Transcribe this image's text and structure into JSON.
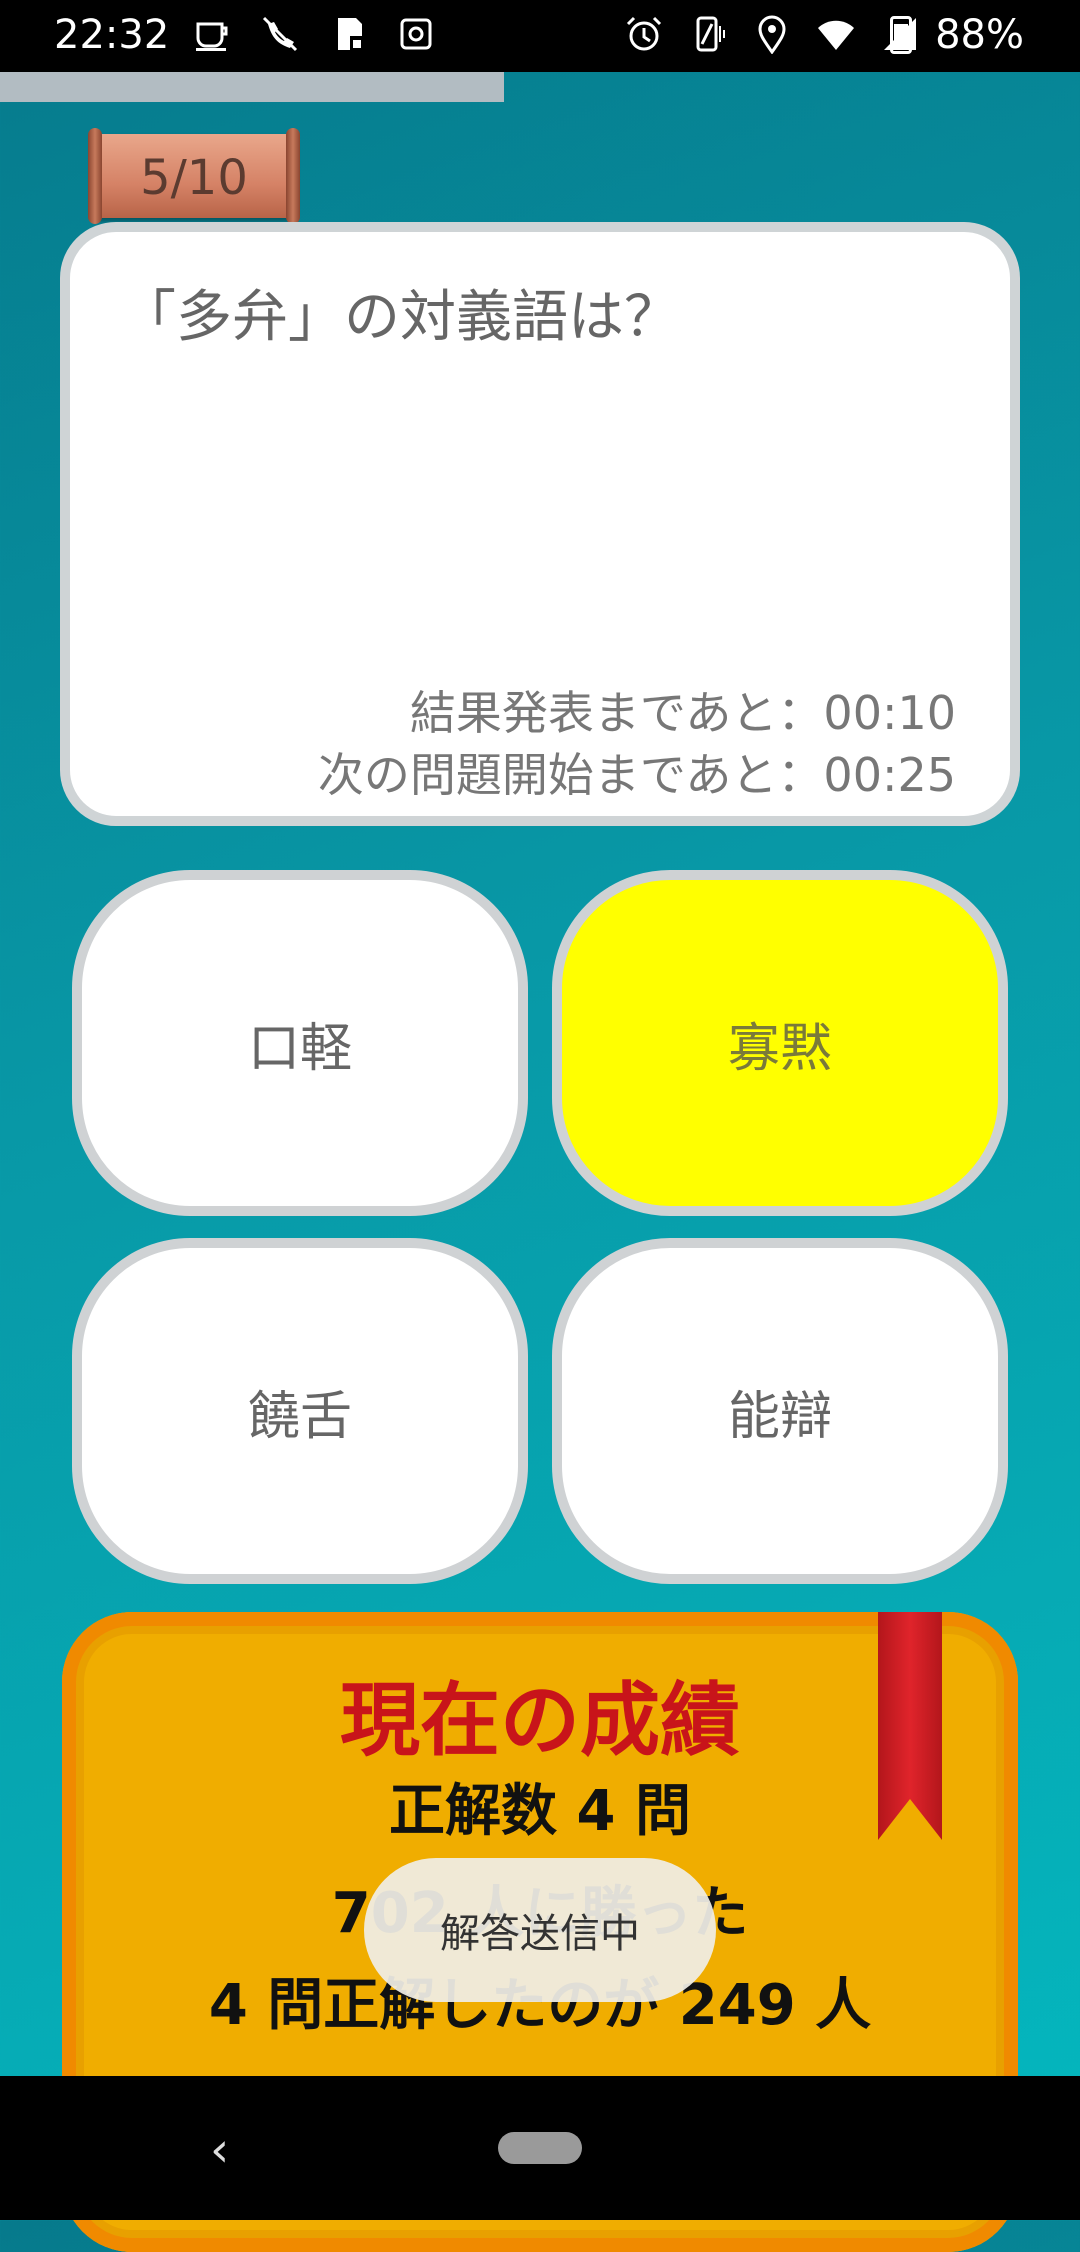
{
  "status_bar": {
    "time": "22:32",
    "battery_percent": "88%",
    "left_icons": [
      "cup-icon",
      "call-off-icon",
      "sd-card-icon",
      "gear-icon"
    ],
    "right_icons": [
      "alarm-icon",
      "vibrate-icon",
      "location-icon",
      "wifi-icon",
      "signal-icon",
      "battery-icon"
    ]
  },
  "progress": {
    "fraction": 0.5
  },
  "question_number": "5/10",
  "question": {
    "text": "「多弁」の対義語は？",
    "result_timer": "結果発表まであと：00:10",
    "next_timer": "次の問題開始まであと：00:25"
  },
  "choices": [
    {
      "label": "口軽",
      "selected": false
    },
    {
      "label": "寡黙",
      "selected": true
    },
    {
      "label": "饒舌",
      "selected": false
    },
    {
      "label": "能辯",
      "selected": false
    }
  ],
  "results": {
    "title": "現在の成績",
    "correct_count": "正解数 4 問",
    "won_against": "702 人に勝った",
    "same_score": "4 問正解したのが 249 人"
  },
  "toast": {
    "text": "解答送信中"
  },
  "navigation": {
    "back_symbol": "‹"
  },
  "colors": {
    "background": "#0899a7",
    "selected_choice": "#ffff00",
    "results_panel": "#f0ad00",
    "results_title": "#c8141a",
    "ribbon": "#e0242b"
  }
}
